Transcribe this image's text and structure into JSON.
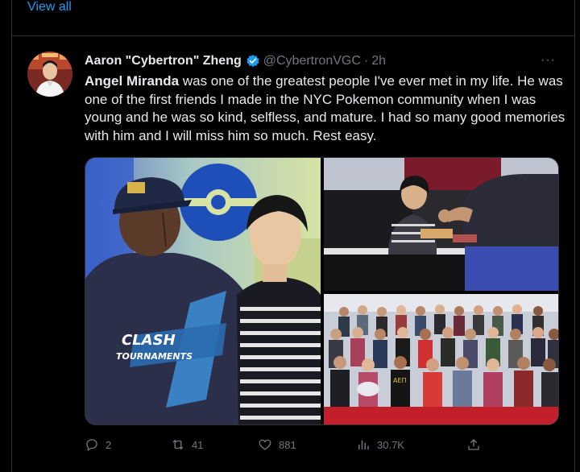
{
  "top": {
    "view_all": "View all"
  },
  "tweet": {
    "author_name": "Aaron \"Cybertron\" Zheng",
    "handle": "@CybertronVGC",
    "separator": "·",
    "time": "2h",
    "more": "···",
    "mention": "Angel Miranda",
    "text_after_mention": " was one of the greatest people I've ever met in my life. He was one of the first friends I made in the NYC Pokemon community when I was young and he was so kind, selfless, and mature. I had so many good memories with him and I will miss him so much. Rest easy.",
    "shirt_text_line1": "CLASH",
    "shirt_text_line2": "TOURNAMENTS",
    "shirt_text_small": "AEΠ"
  },
  "actions": {
    "replies": "2",
    "reposts": "41",
    "likes": "881",
    "views": "30.7K"
  },
  "colors": {
    "link": "#1d9bf0",
    "muted": "#71767b",
    "text": "#e7e9ea",
    "bg": "#000000",
    "verified": "#1d9bf0"
  },
  "icons": [
    "reply-icon",
    "repost-icon",
    "like-icon",
    "views-icon",
    "share-icon",
    "verified-icon",
    "more-icon"
  ]
}
